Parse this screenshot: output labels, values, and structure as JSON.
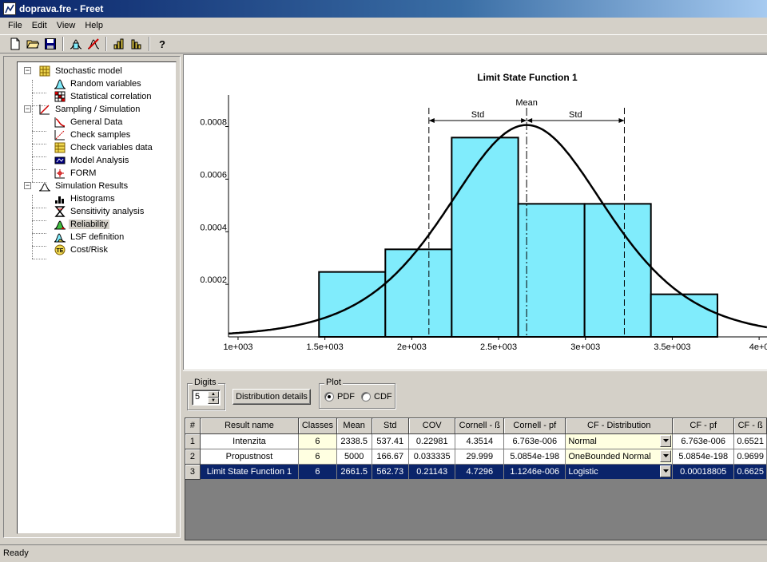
{
  "window": {
    "title": "doprava.fre - Freet"
  },
  "menu": [
    "File",
    "Edit",
    "View",
    "Help"
  ],
  "toolbar": {
    "buttons": [
      "new-file-icon",
      "open-folder-icon",
      "save-icon",
      "model-icon",
      "simulation-icon",
      "sample-icon",
      "results-icon",
      "help-icon"
    ]
  },
  "tree": {
    "nodes": [
      {
        "label": "Stochastic model",
        "icon": "grid-icon",
        "level": 0,
        "expanded": true
      },
      {
        "label": "Random variables",
        "icon": "bell-curve-icon",
        "level": 1
      },
      {
        "label": "Statistical correlation",
        "icon": "correlation-matrix-icon",
        "level": 1
      },
      {
        "label": "Sampling / Simulation",
        "icon": "sampling-icon",
        "level": 0,
        "expanded": true
      },
      {
        "label": "General Data",
        "icon": "general-data-icon",
        "level": 1
      },
      {
        "label": "Check samples",
        "icon": "check-samples-icon",
        "level": 1
      },
      {
        "label": "Check variables data",
        "icon": "variables-data-icon",
        "level": 1
      },
      {
        "label": "Model Analysis",
        "icon": "model-analysis-icon",
        "level": 1
      },
      {
        "label": "FORM",
        "icon": "form-icon",
        "level": 1
      },
      {
        "label": "Simulation Results",
        "icon": "results-icon",
        "level": 0,
        "expanded": true
      },
      {
        "label": "Histograms",
        "icon": "histogram-icon",
        "level": 1
      },
      {
        "label": "Sensitivity analysis",
        "icon": "sensitivity-icon",
        "level": 1
      },
      {
        "label": "Reliability",
        "icon": "reliability-icon",
        "level": 1,
        "selected": true
      },
      {
        "label": "LSF definition",
        "icon": "lsf-icon",
        "level": 1
      },
      {
        "label": "Cost/Risk",
        "icon": "cost-risk-icon",
        "level": 1
      }
    ]
  },
  "chart_data": {
    "type": "bar",
    "title": "Limit State Function 1",
    "bins": [
      {
        "from": 1466,
        "to": 1848,
        "value": 0.000247
      },
      {
        "from": 1848,
        "to": 2230,
        "value": 0.000333
      },
      {
        "from": 2230,
        "to": 2613,
        "value": 0.000758
      },
      {
        "from": 2613,
        "to": 2995,
        "value": 0.000506
      },
      {
        "from": 2995,
        "to": 3377,
        "value": 0.000506
      },
      {
        "from": 3377,
        "to": 3760,
        "value": 0.000162
      }
    ],
    "curve": {
      "name": "Logistic",
      "mean": 2661.5,
      "std": 562.73
    },
    "xlim": [
      945,
      4050
    ],
    "ylim": [
      0,
      0.00092
    ],
    "xticks": [
      {
        "v": 1000,
        "label": "1e+003"
      },
      {
        "v": 1500,
        "label": "1.5e+003"
      },
      {
        "v": 2000,
        "label": "2e+003"
      },
      {
        "v": 2500,
        "label": "2.5e+003"
      },
      {
        "v": 3000,
        "label": "3e+003"
      },
      {
        "v": 3500,
        "label": "3.5e+003"
      },
      {
        "v": 4000,
        "label": "4e+0"
      }
    ],
    "yticks": [
      {
        "v": 0.0002,
        "label": "0.0002"
      },
      {
        "v": 0.0004,
        "label": "0.0004"
      },
      {
        "v": 0.0006,
        "label": "0.0006"
      },
      {
        "v": 0.0008,
        "label": "0.0008"
      }
    ],
    "annotations": {
      "mean": "Mean",
      "std": "Std"
    },
    "colors": {
      "bar": "#80ecfc",
      "curve": "#000000"
    }
  },
  "controls": {
    "digits_label": "Digits",
    "digits_value": "5",
    "details_button": "Distribution details",
    "plot_label": "Plot",
    "pdf_label": "PDF",
    "cdf_label": "CDF",
    "plot_selected": "PDF"
  },
  "table": {
    "headers": [
      "#",
      "Result name",
      "Classes",
      "Mean",
      "Std",
      "COV",
      "Cornell - ß",
      "Cornell - pf",
      "CF - Distribution",
      "CF - pf",
      "CF - ß"
    ],
    "rows": [
      [
        "1",
        "Intenzita",
        "6",
        "2338.5",
        "537.41",
        "0.22981",
        "4.3514",
        "6.763e-006",
        "Normal",
        "6.763e-006",
        "0.6521"
      ],
      [
        "2",
        "Propustnost",
        "6",
        "5000",
        "166.67",
        "0.033335",
        "29.999",
        "5.0854e-198",
        "OneBounded Normal",
        "5.0854e-198",
        "0.9699"
      ],
      [
        "3",
        "Limit State Function 1",
        "6",
        "2661.5",
        "562.73",
        "0.21143",
        "4.7296",
        "1.1246e-006",
        "Logistic",
        "0.00018805",
        "0.6625"
      ]
    ],
    "selected_row": 2
  },
  "status": {
    "text": "Ready"
  }
}
